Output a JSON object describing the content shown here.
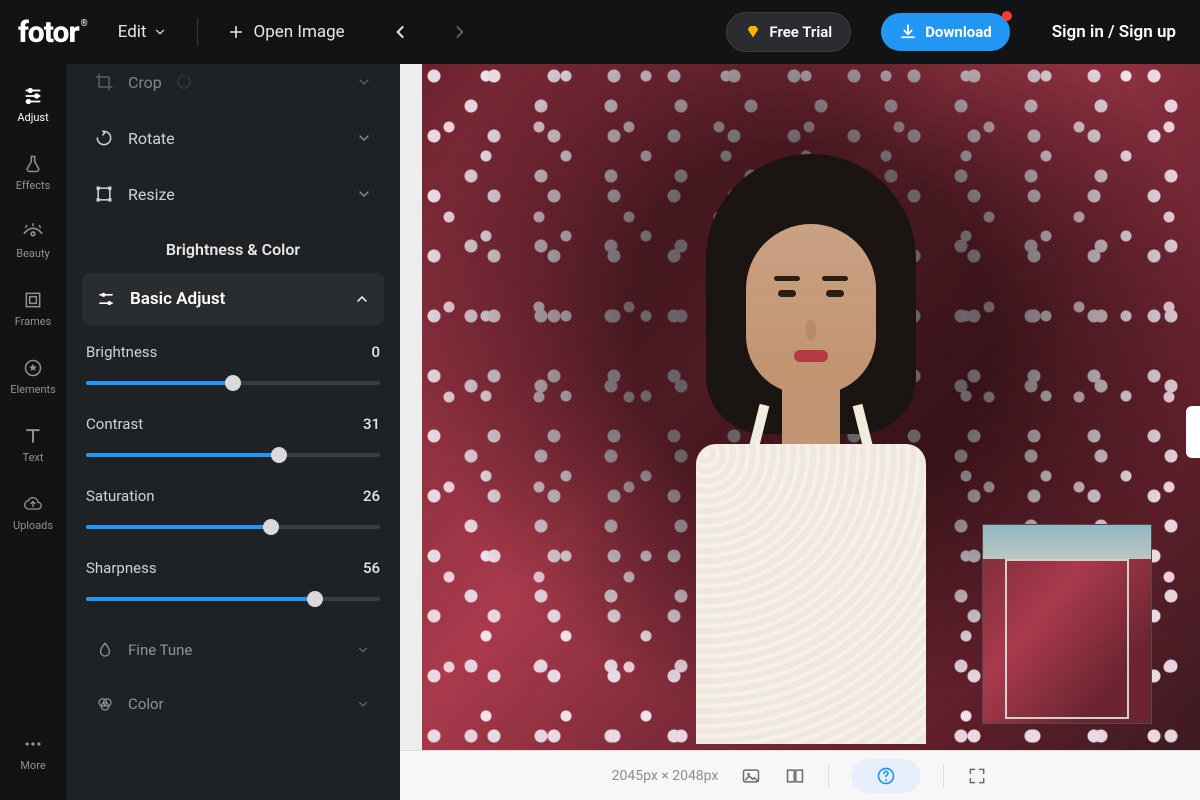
{
  "header": {
    "logo": "fotor",
    "edit_label": "Edit",
    "open_image_label": "Open Image",
    "free_trial_label": "Free Trial",
    "download_label": "Download",
    "signin_label": "Sign in / Sign up"
  },
  "siderail": {
    "items": [
      {
        "label": "Adjust"
      },
      {
        "label": "Effects"
      },
      {
        "label": "Beauty"
      },
      {
        "label": "Frames"
      },
      {
        "label": "Elements"
      },
      {
        "label": "Text"
      },
      {
        "label": "Uploads"
      }
    ],
    "more_label": "More"
  },
  "panel": {
    "crop_label": "Crop",
    "rotate_label": "Rotate",
    "resize_label": "Resize",
    "section_title": "Brightness & Color",
    "basic_adjust_label": "Basic Adjust",
    "sliders": [
      {
        "label": "Brightness",
        "value": 0,
        "min": -100,
        "max": 100
      },
      {
        "label": "Contrast",
        "value": 31,
        "min": -100,
        "max": 100
      },
      {
        "label": "Saturation",
        "value": 26,
        "min": -100,
        "max": 100
      },
      {
        "label": "Sharpness",
        "value": 56,
        "min": -100,
        "max": 100
      }
    ],
    "fine_tune_label": "Fine Tune",
    "color_label": "Color"
  },
  "bottombar": {
    "dimensions": "2045px × 2048px"
  }
}
